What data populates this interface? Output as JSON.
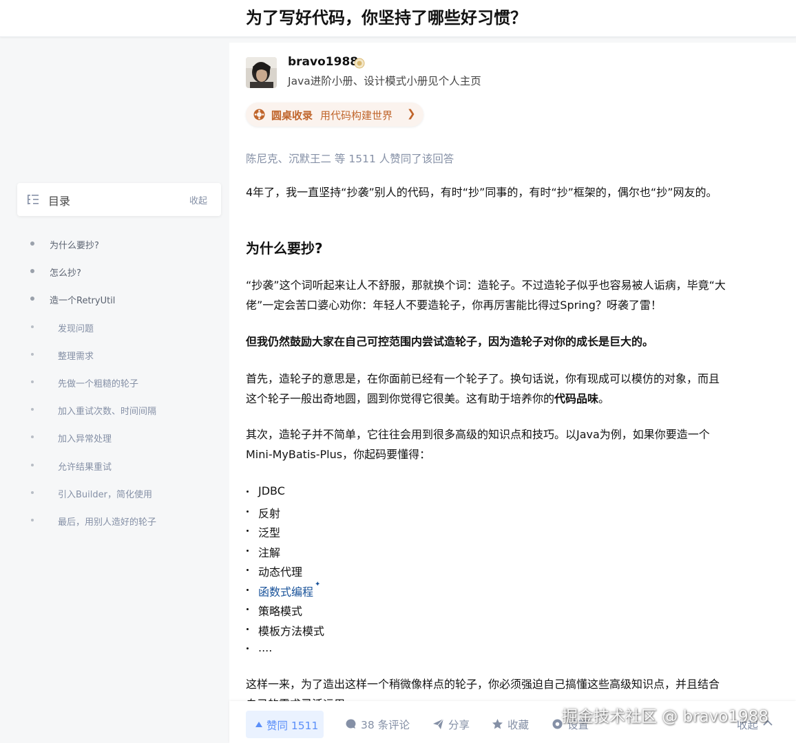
{
  "header": {
    "title": "为了写好代码，你坚持了哪些好习惯？"
  },
  "toc": {
    "title": "目录",
    "collapse_label": "收起",
    "items": [
      {
        "label": "为什么要抄?",
        "level": 1
      },
      {
        "label": "怎么抄?",
        "level": 1
      },
      {
        "label": "造一个RetryUtil",
        "level": 1
      },
      {
        "label": "发现问题",
        "level": 2
      },
      {
        "label": "整理需求",
        "level": 2
      },
      {
        "label": "先做一个粗糙的轮子",
        "level": 2
      },
      {
        "label": "加入重试次数、时间间隔",
        "level": 2
      },
      {
        "label": "加入异常处理",
        "level": 2
      },
      {
        "label": "允许结果重试",
        "level": 2
      },
      {
        "label": "引入Builder，简化使用",
        "level": 2
      },
      {
        "label": "最后，用别人造好的轮子",
        "level": 2
      }
    ]
  },
  "author": {
    "name": "bravo1988",
    "bio": "Java进阶小册、设计模式小册见个人主页"
  },
  "collection": {
    "label": "圆桌收录",
    "text": "用代码构建世界",
    "chevron": "❯"
  },
  "voters_text": "陈尼克、沉默王二 等 1511 人赞同了该回答",
  "article": {
    "intro": "4年了，我一直坚持“抄袭”别人的代码，有时“抄”同事的，有时“抄”框架的，偶尔也“抄”网友的。",
    "heading": "为什么要抄?",
    "p1_line1": "“抄袭”这个词听起来让人不舒服，那就换个词：造轮子。不过造轮子似乎也容易被人诟病，毕竟“大",
    "p1_line2": "佬”一定会苦口婆心劝你：年轻人不要造轮子，你再厉害能比得过Spring？呀袭了雷！",
    "p2": "但我仍然鼓励大家在自己可控范围内尝试造轮子，因为造轮子对你的成长是巨大的。",
    "p3_line1": "首先，造轮子的意思是，在你面前已经有一个轮子了。换句话说，你有现成可以模仿的对象，而且",
    "p3_line2_pre": "这个轮子一般出奇地圆，圆到你觉得它很美。这有助于培养你的",
    "p3_line2_bold": "代码品味",
    "p3_line2_post": "。",
    "p4_line1": "其次，造轮子并不简单，它往往会用到很多高级的知识点和技巧。以Java为例，如果你要造一个",
    "p4_line2": "Mini-MyBatis-Plus，你起码要懂得：",
    "bullets": [
      "JDBC",
      "反射",
      "泛型",
      "注解",
      "动态代理",
      "函数式编程",
      "策略模式",
      "模板方法模式",
      "...."
    ],
    "bullet_link_index": 5,
    "p5_line1": "这样一来，为了造出这样一个稍微像样点的轮子，你必须强迫自己搞懂这些高级知识点，并且结合",
    "p5_line2": "自己的需求灵活运用"
  },
  "actions": {
    "vote": "赞同 1511",
    "comments": "38 条评论",
    "share": "分享",
    "favorite": "收藏",
    "settings": "设置",
    "collapse": "收起"
  },
  "watermark": "掘金技术社区 @ bravo1988",
  "colors": {
    "accent": "#5b8ff9",
    "link": "#175199",
    "collection": "#c0652b",
    "muted": "#8590a6"
  }
}
